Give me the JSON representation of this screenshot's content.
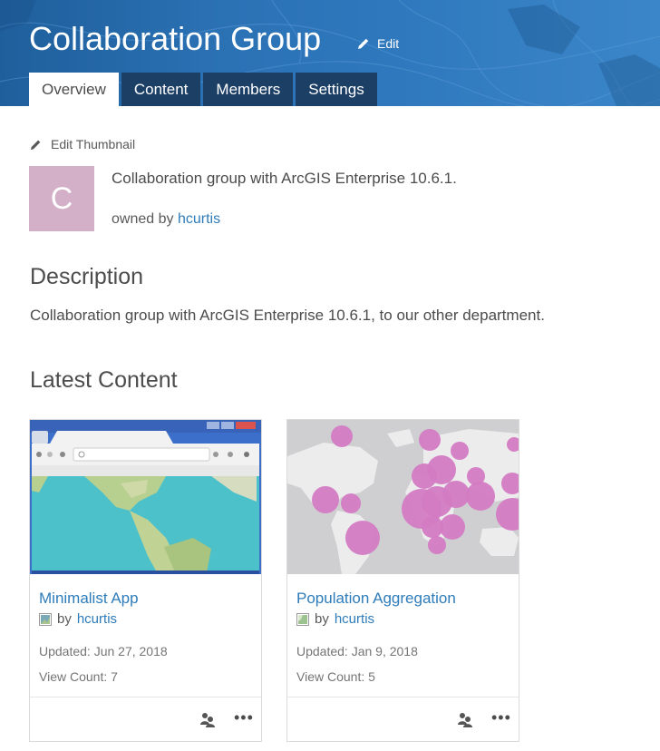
{
  "group": {
    "title": "Collaboration Group",
    "edit_label": "Edit",
    "tabs": [
      {
        "label": "Overview",
        "active": true
      },
      {
        "label": "Content",
        "active": false
      },
      {
        "label": "Members",
        "active": false
      },
      {
        "label": "Settings",
        "active": false
      }
    ]
  },
  "thumbnail": {
    "edit_label": "Edit Thumbnail",
    "letter": "C",
    "color": "#d3b0c7"
  },
  "summary": {
    "text": "Collaboration group with ArcGIS Enterprise 10.6.1.",
    "owned_by_prefix": "owned by",
    "owner": "hcurtis"
  },
  "description": {
    "heading": "Description",
    "text": "Collaboration group with ArcGIS Enterprise 10.6.1, to our other department."
  },
  "latest_content": {
    "heading": "Latest Content",
    "items": [
      {
        "title": "Minimalist App",
        "type_icon": "web-app-icon",
        "by_prefix": "by",
        "owner": "hcurtis",
        "updated": "Updated: Jun 27, 2018",
        "views": "View Count: 7",
        "thumbnail": "browser-window-map-screenshot"
      },
      {
        "title": "Population Aggregation",
        "type_icon": "map-service-icon",
        "by_prefix": "by",
        "owner": "hcurtis",
        "updated": "Updated: Jan 9, 2018",
        "views": "View Count: 5",
        "thumbnail": "world-map-proportional-circles"
      }
    ]
  },
  "colors": {
    "banner": "#2b72b5",
    "tab_inactive": "#1c3f66",
    "link": "#2e7cba",
    "bubble": "#d37bc4"
  }
}
